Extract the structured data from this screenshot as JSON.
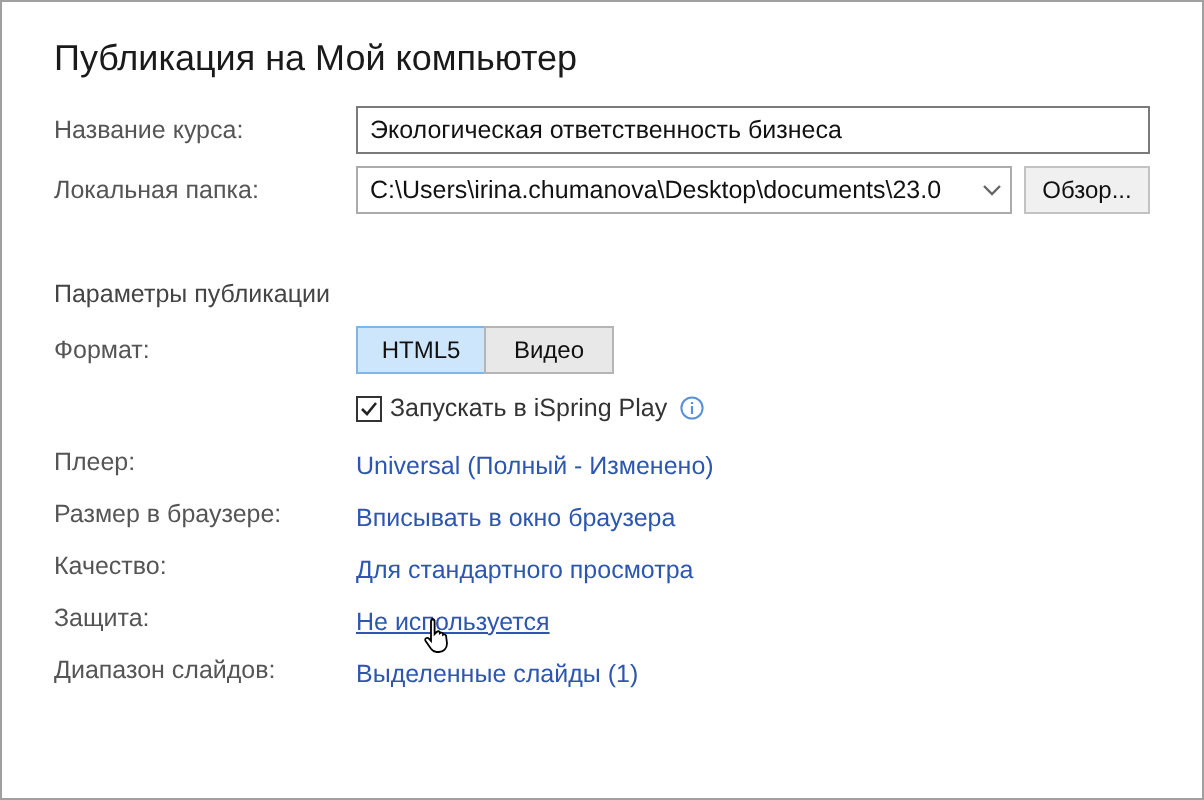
{
  "title": "Публикация на Мой компьютер",
  "course_name": {
    "label": "Название курса:",
    "value": "Экологическая ответственность бизнеса"
  },
  "local_folder": {
    "label": "Локальная папка:",
    "value": "C:\\Users\\irina.chumanova\\Desktop\\documents\\23.0",
    "browse_button": "Обзор..."
  },
  "section_title": "Параметры публикации",
  "format": {
    "label": "Формат:",
    "options": [
      {
        "label": "HTML5",
        "selected": true
      },
      {
        "label": "Видео",
        "selected": false
      }
    ]
  },
  "ispring_play": {
    "label": "Запускать в iSpring Play",
    "checked": true
  },
  "settings": [
    {
      "label": "Плеер:",
      "value": "Universal (Полный - Изменено)",
      "hovered": false
    },
    {
      "label": "Размер в браузере:",
      "value": "Вписывать в окно браузера",
      "hovered": false
    },
    {
      "label": "Качество:",
      "value": "Для стандартного просмотра",
      "hovered": false
    },
    {
      "label": "Защита:",
      "value": "Не используется",
      "hovered": true
    },
    {
      "label": "Диапазон слайдов:",
      "value": "Выделенные слайды (1)",
      "hovered": false
    }
  ]
}
